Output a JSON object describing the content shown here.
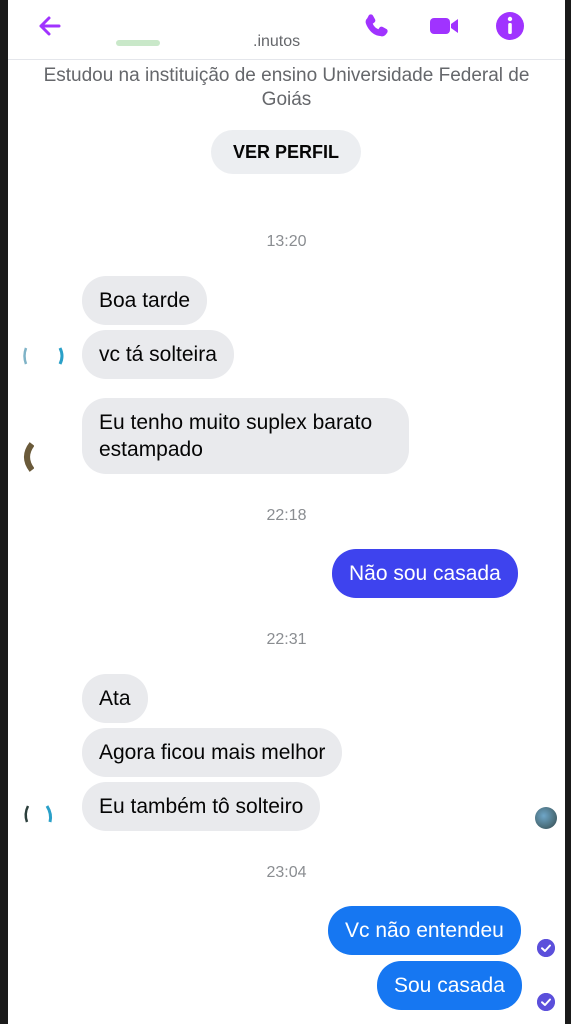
{
  "header": {
    "contact_status": ".inutos",
    "icons": {
      "back": "arrow-left-icon",
      "call": "phone-icon",
      "video": "video-camera-icon",
      "info": "info-icon"
    }
  },
  "profile": {
    "education": "Estudou na instituição de ensino Universidade Federal de Goiás",
    "button_label": "VER PERFIL"
  },
  "messages": {
    "ts1": "13:20",
    "m1": "Boa tarde",
    "m2": "vc tá solteira",
    "m3": "Eu tenho muito suplex barato estampado",
    "ts2": "22:18",
    "m4": "Não sou casada",
    "ts3": "22:31",
    "m5": "Ata",
    "m6": "Agora ficou  mais melhor",
    "m7": "Eu também tô solteiro",
    "ts4": "23:04",
    "m8": "Vc não entendeu",
    "m9": "Sou casada"
  },
  "colors": {
    "accent": "#a033ff",
    "outgoing_bubble": "#3e43ee",
    "outgoing_bubble_light": "#1677f2",
    "incoming_bubble": "#e9eaed"
  }
}
